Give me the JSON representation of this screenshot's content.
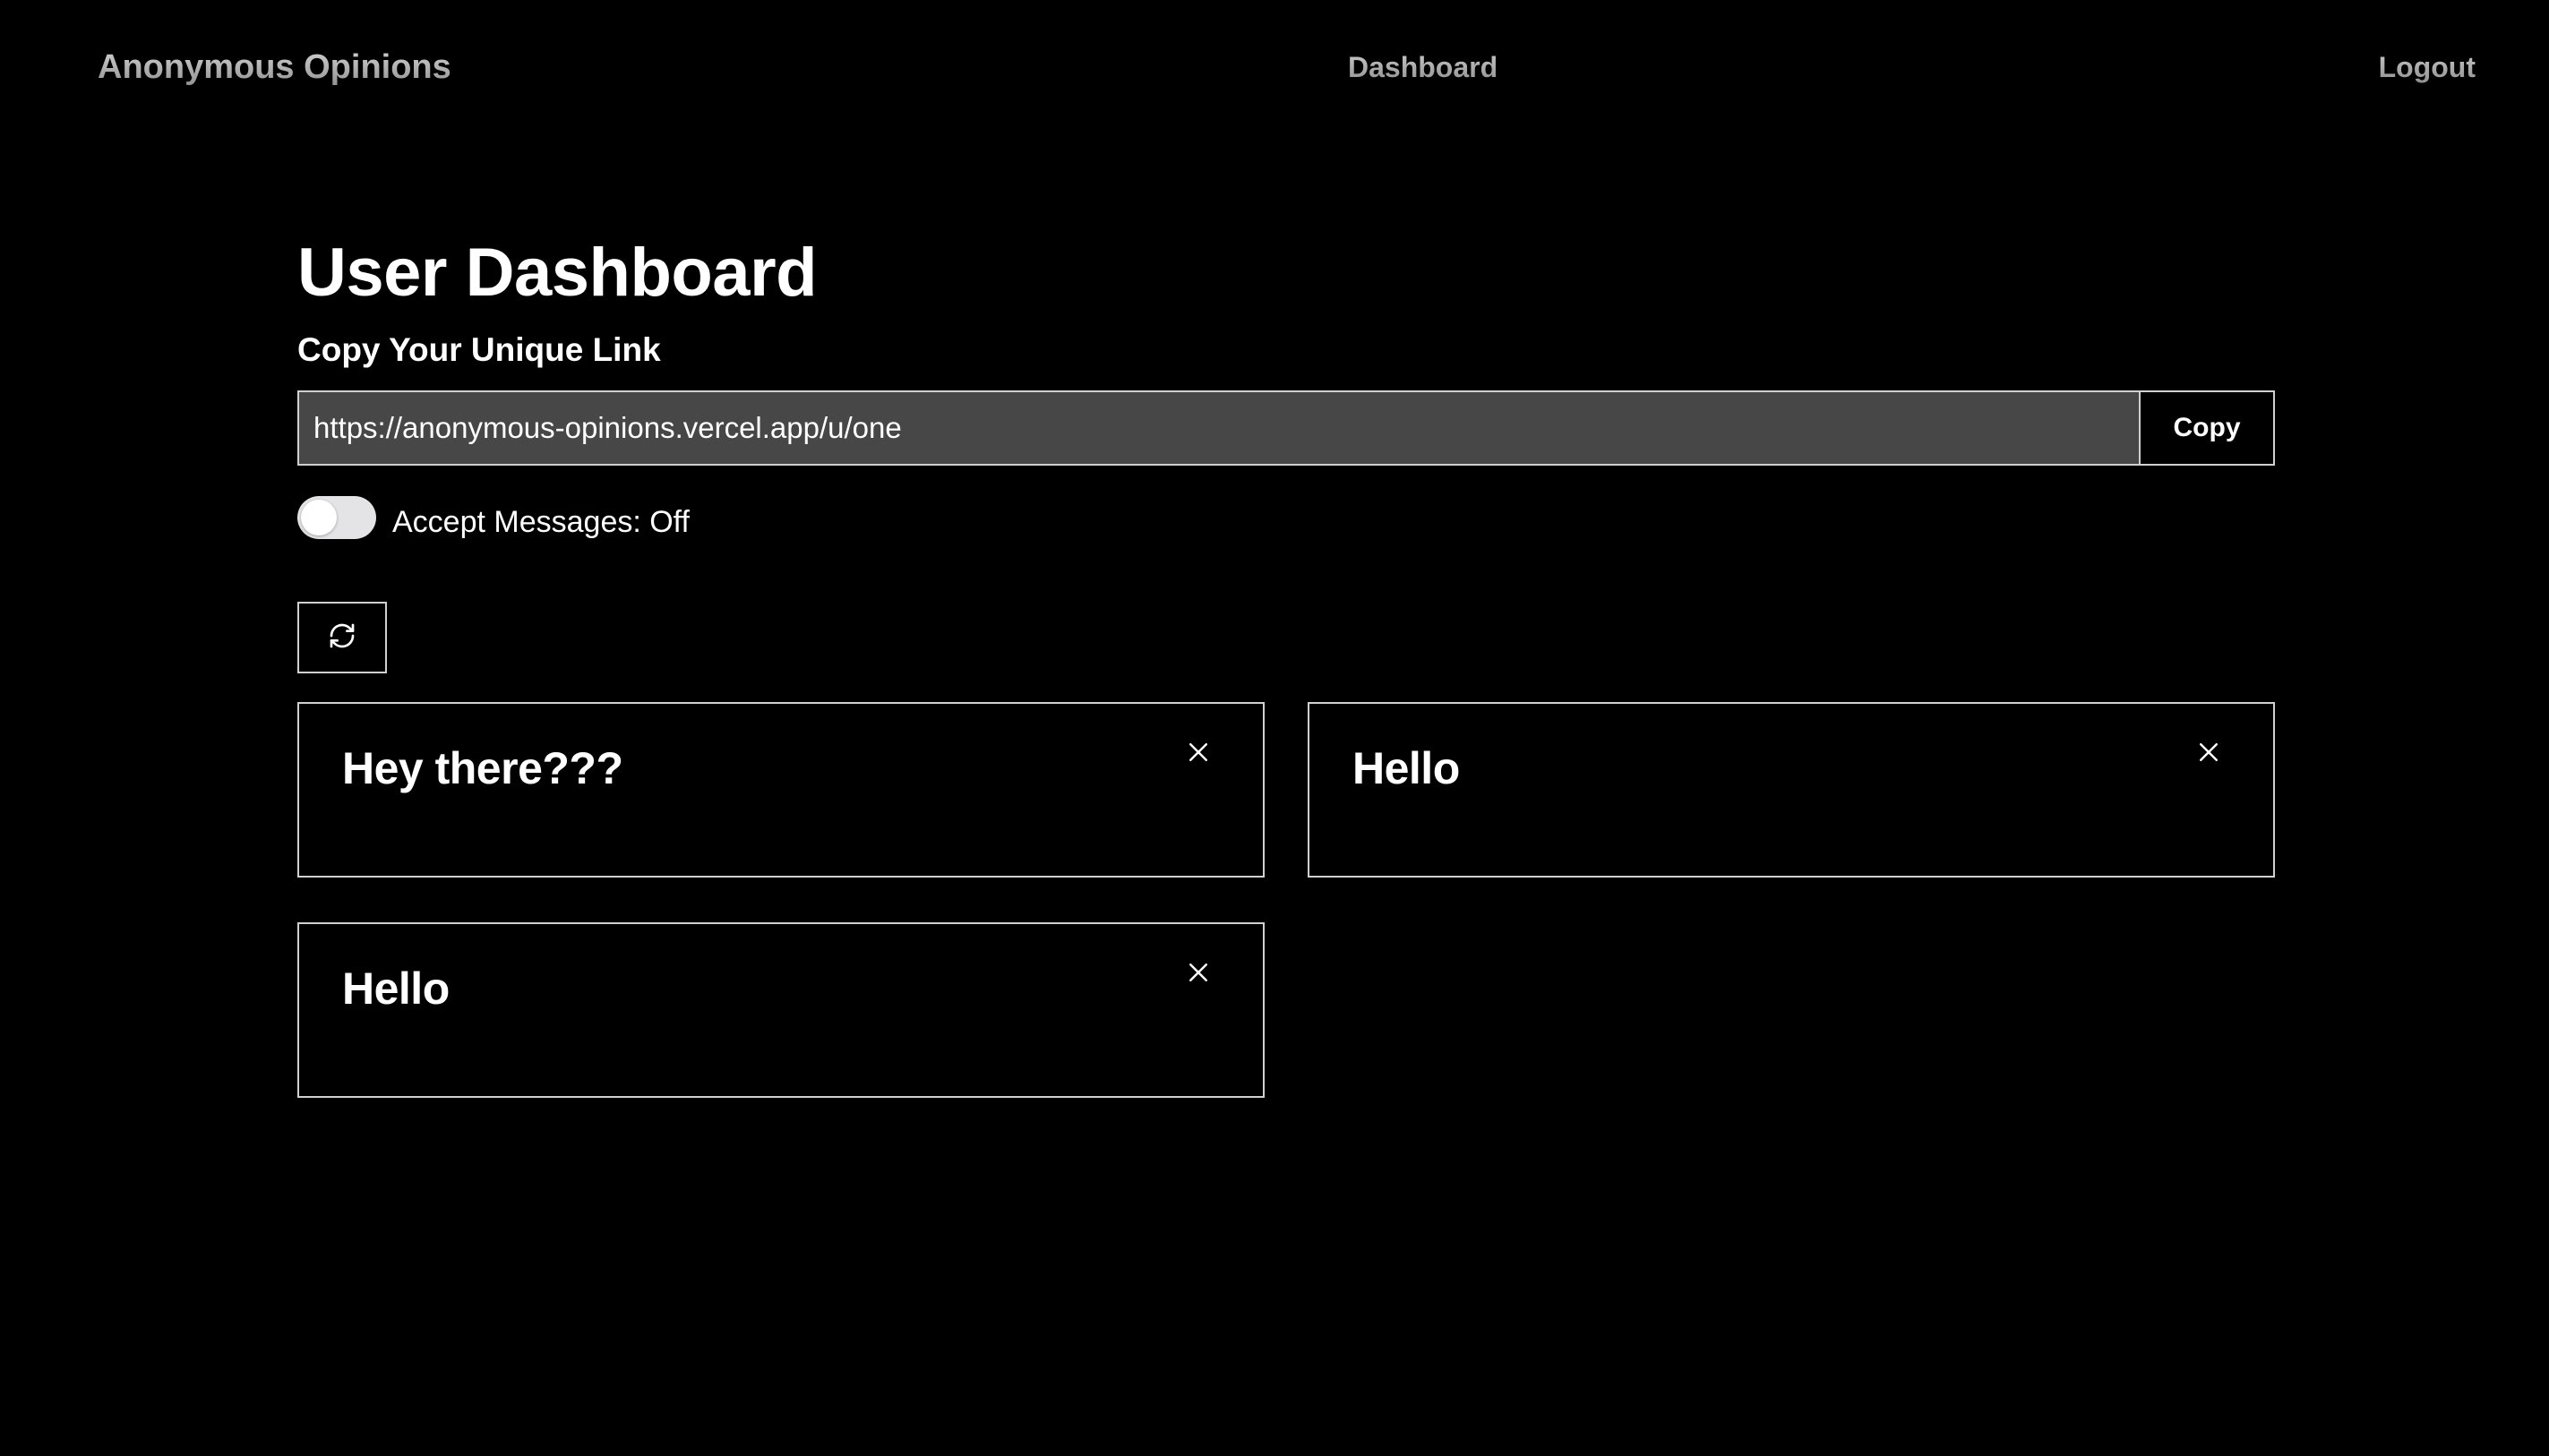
{
  "nav": {
    "brand": "Anonymous Opinions",
    "dashboard_link": "Dashboard",
    "logout_link": "Logout"
  },
  "page": {
    "title": "User Dashboard",
    "copy_link_label": "Copy Your Unique Link",
    "unique_link": "https://anonymous-opinions.vercel.app/u/one",
    "copy_button": "Copy",
    "accept_messages_label": "Accept Messages: Off",
    "accept_messages_on": false
  },
  "icons": {
    "refresh": "refresh-icon",
    "close": "close-icon"
  },
  "messages": [
    {
      "content": "Hey there???"
    },
    {
      "content": "Hello"
    },
    {
      "content": "Hello"
    }
  ],
  "colors": {
    "background": "#000000",
    "text": "#ffffff",
    "input_bg": "#474747",
    "border": "#d0d0d0",
    "switch_track": "#e4e4e7"
  }
}
